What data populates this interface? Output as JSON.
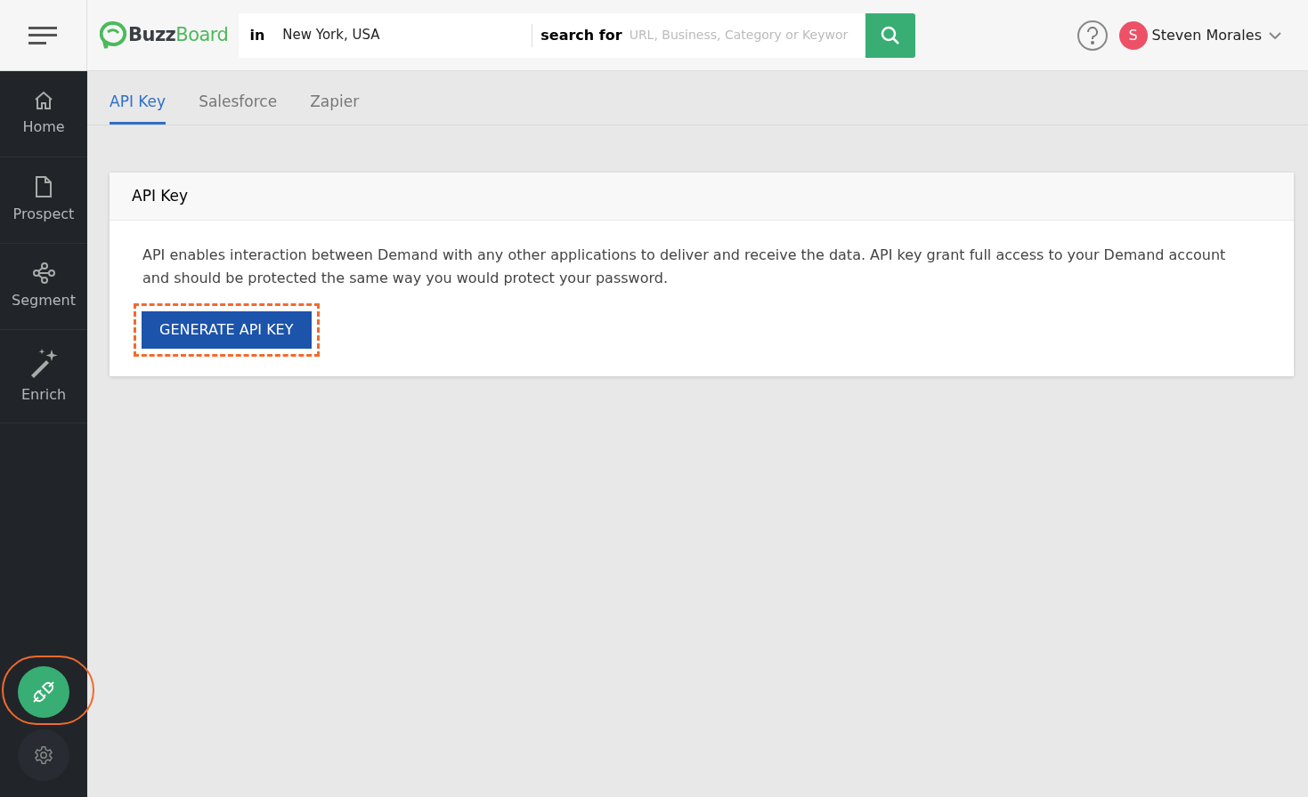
{
  "header": {
    "logo": {
      "part_1": "Buzz",
      "part_2": "Board"
    },
    "location": {
      "prefix": "in",
      "value": "New York, USA"
    },
    "search": {
      "label": "search for",
      "placeholder": "URL, Business, Category or Keywor"
    },
    "user": {
      "initial": "S",
      "name": "Steven Morales"
    }
  },
  "sidebar": {
    "items": [
      {
        "kind": "home",
        "label": "Home",
        "selected": false
      },
      {
        "kind": "prospect",
        "label": "Prospect",
        "selected": false
      },
      {
        "kind": "segment",
        "label": "Segment",
        "selected": false
      },
      {
        "kind": "enrich",
        "label": "Enrich",
        "selected": false
      }
    ],
    "bottom": [
      {
        "kind": "integrations",
        "selected": true,
        "highlighted": true
      },
      {
        "kind": "settings",
        "selected": false,
        "highlighted": false
      }
    ]
  },
  "tabs": [
    {
      "label": "API Key",
      "selected": true
    },
    {
      "label": "Salesforce",
      "selected": false
    },
    {
      "label": "Zapier",
      "selected": false
    }
  ],
  "card": {
    "title": "API Key",
    "text": "API enables interaction between Demand with any other applications to deliver and receive the data. API key grant full access to your Demand account and should be protected the same way you would protect your password.",
    "button": {
      "label": "GENERATE API KEY",
      "highlighted": true
    }
  }
}
